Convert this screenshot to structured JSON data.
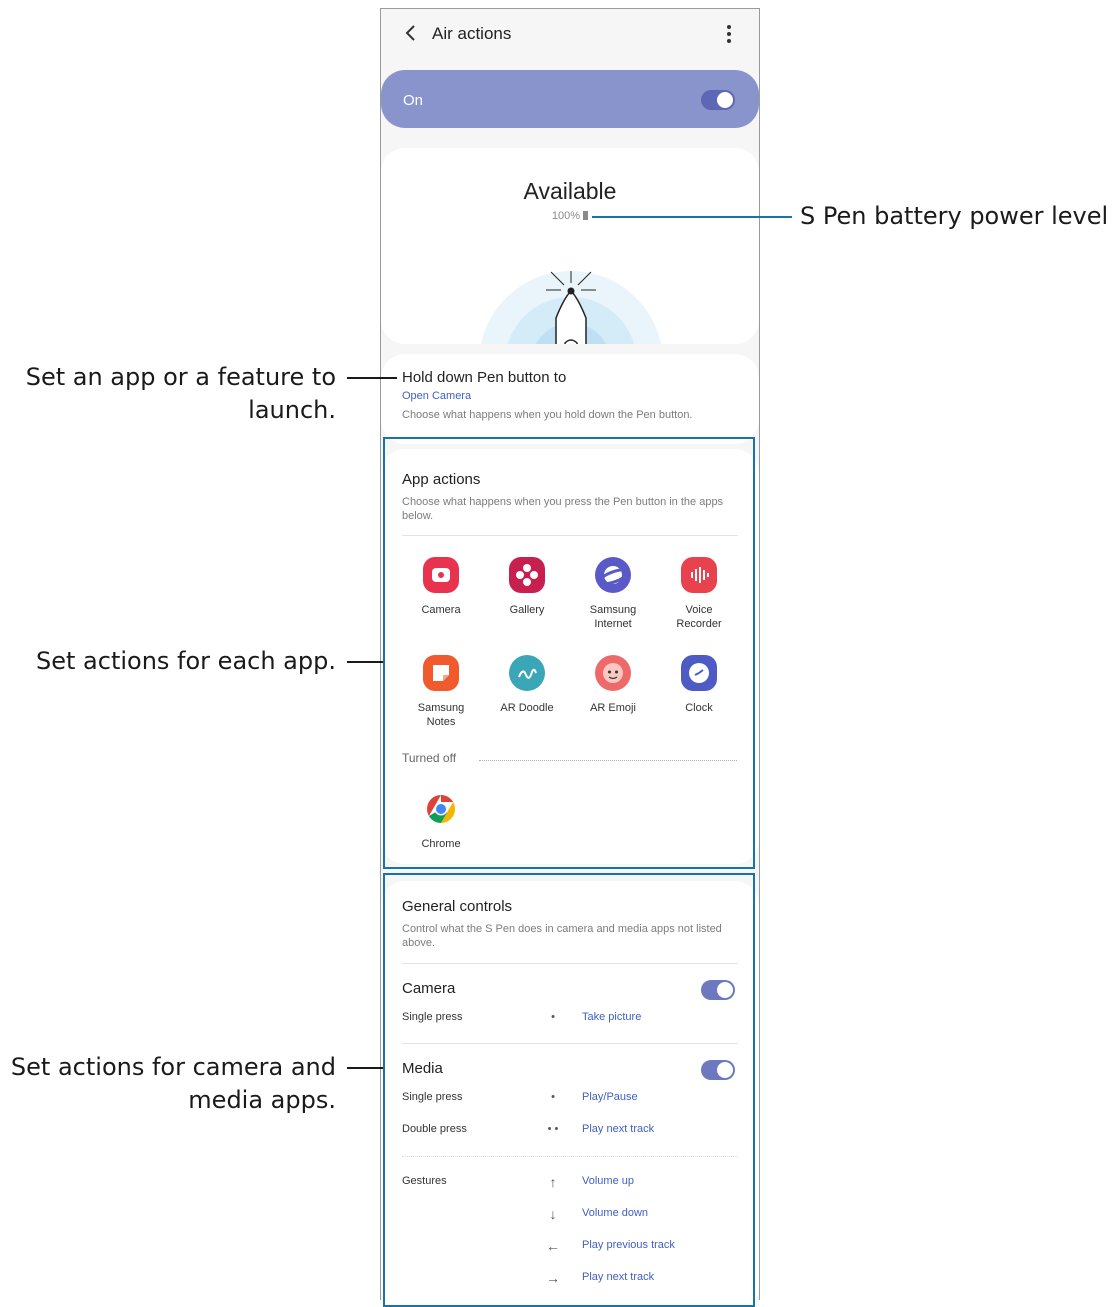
{
  "header": {
    "title": "Air actions"
  },
  "master_switch": {
    "label": "On",
    "state": "on"
  },
  "pen_status": {
    "status": "Available",
    "battery": "100%"
  },
  "hold_down": {
    "title": "Hold down Pen button to",
    "value": "Open Camera",
    "description": "Choose what happens when you hold down the Pen button."
  },
  "app_actions": {
    "title": "App actions",
    "description": "Choose what happens when you press the Pen button in the apps below.",
    "apps": [
      {
        "name": "Camera",
        "icon": "camera-icon",
        "color": "#e8334f"
      },
      {
        "name": "Gallery",
        "icon": "gallery-icon",
        "color": "#c7204f"
      },
      {
        "name": "Samsung Internet",
        "icon": "internet-icon",
        "color": "#5a59c8"
      },
      {
        "name": "Voice Recorder",
        "icon": "voice-recorder-icon",
        "color": "#e8424f"
      },
      {
        "name": "Samsung Notes",
        "icon": "notes-icon",
        "color": "#f05a2c"
      },
      {
        "name": "AR Doodle",
        "icon": "ar-doodle-icon",
        "color": "#3aa6b8"
      },
      {
        "name": "AR Emoji",
        "icon": "ar-emoji-icon",
        "color": "#ee6a6a"
      },
      {
        "name": "Clock",
        "icon": "clock-icon",
        "color": "#4f5bc4"
      }
    ],
    "turned_off_label": "Turned off",
    "turned_off_apps": [
      {
        "name": "Chrome",
        "icon": "chrome-icon"
      }
    ]
  },
  "general_controls": {
    "title": "General controls",
    "description": "Control what the S Pen does in camera and media apps not listed above.",
    "camera": {
      "title": "Camera",
      "state": "on",
      "rows": [
        {
          "label": "Single press",
          "gesture": "•",
          "action": "Take picture"
        }
      ]
    },
    "media": {
      "title": "Media",
      "state": "on",
      "rows": [
        {
          "label": "Single press",
          "gesture": "•",
          "action": "Play/Pause"
        },
        {
          "label": "Double press",
          "gesture": "• •",
          "action": "Play next track"
        }
      ]
    },
    "gestures": {
      "label": "Gestures",
      "rows": [
        {
          "gesture": "↑",
          "action": "Volume up"
        },
        {
          "gesture": "↓",
          "action": "Volume down"
        },
        {
          "gesture": "←",
          "action": "Play previous track"
        },
        {
          "gesture": "→",
          "action": "Play next track"
        }
      ]
    }
  },
  "annotations": {
    "battery": "S Pen battery power level",
    "hold_1": "Set an app or a feature to",
    "hold_2": "launch.",
    "apps": "Set actions for each app.",
    "general_1": "Set actions for camera and",
    "general_2": "media apps."
  },
  "colors": {
    "accent": "#5d68b4",
    "link": "#3f5fc4",
    "highlight": "#1a73a8"
  }
}
